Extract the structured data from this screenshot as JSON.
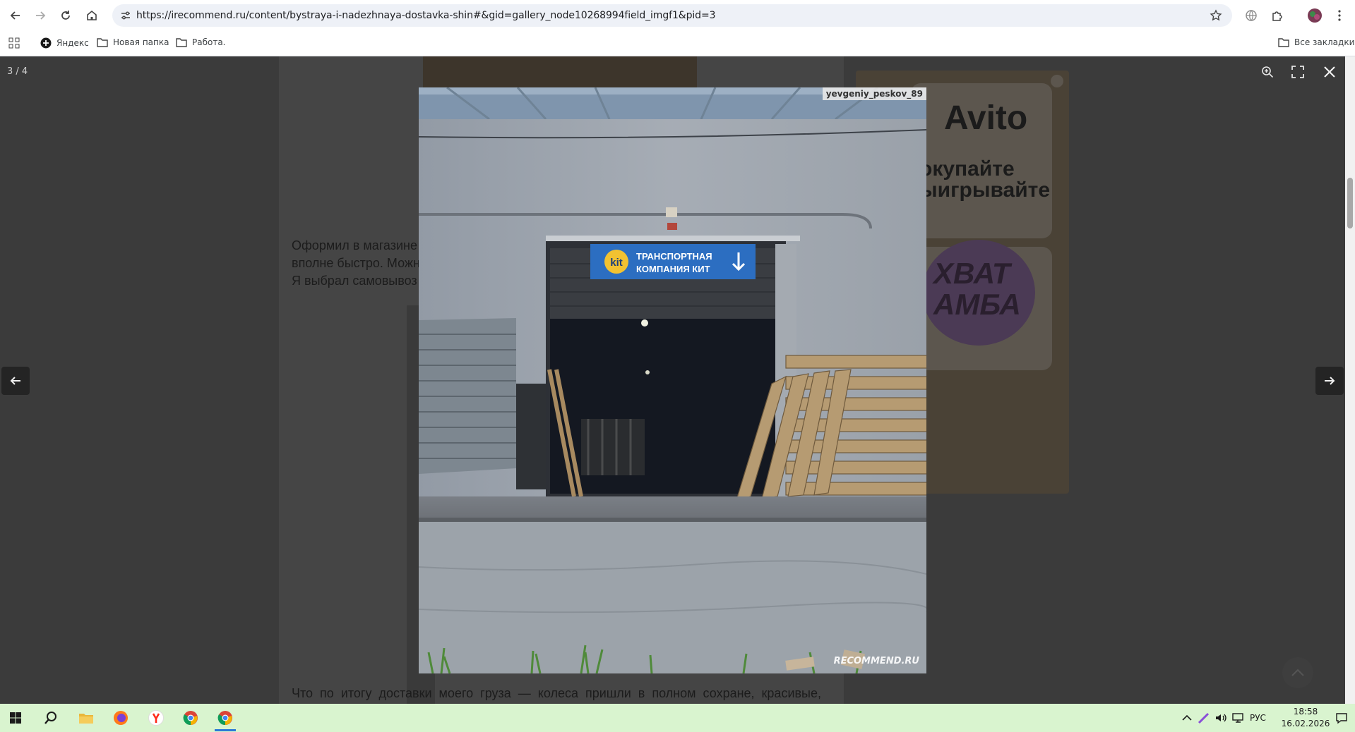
{
  "browser": {
    "url": "https://irecommend.ru/content/bystraya-i-nadezhnaya-dostavka-shin#&gid=gallery_node10268994field_imgf1&pid=3",
    "bookmarks": [
      "Яндекс",
      "Новая папка",
      "Работа."
    ],
    "all_bookmarks_label": "Все закладки"
  },
  "article": {
    "para1_lines": [
      "Оформил в магазине",
      "вполне быстро. Можн",
      "Я выбрал самовывоз"
    ],
    "para2": "Что  по  итогу  доставки  моего  груза  —  колеса  пришли  в  полном  сохране,  красивые,"
  },
  "ad": {
    "brand": "Avito",
    "lines": [
      "окупайте",
      "ыигрывайте"
    ],
    "promo": "ХВАТ\nАМБА"
  },
  "gallery": {
    "counter": "3 / 4",
    "author": "yevgeniy_peskov_89",
    "watermark": "RECOMMEND.RU",
    "sign_line1": "ТРАНСПОРТНАЯ",
    "sign_line2": "КОМПАНИЯ КИТ",
    "sign_logo": "kit"
  },
  "taskbar": {
    "language": "РУС",
    "time": "18:58",
    "date": "16.02.2026"
  }
}
